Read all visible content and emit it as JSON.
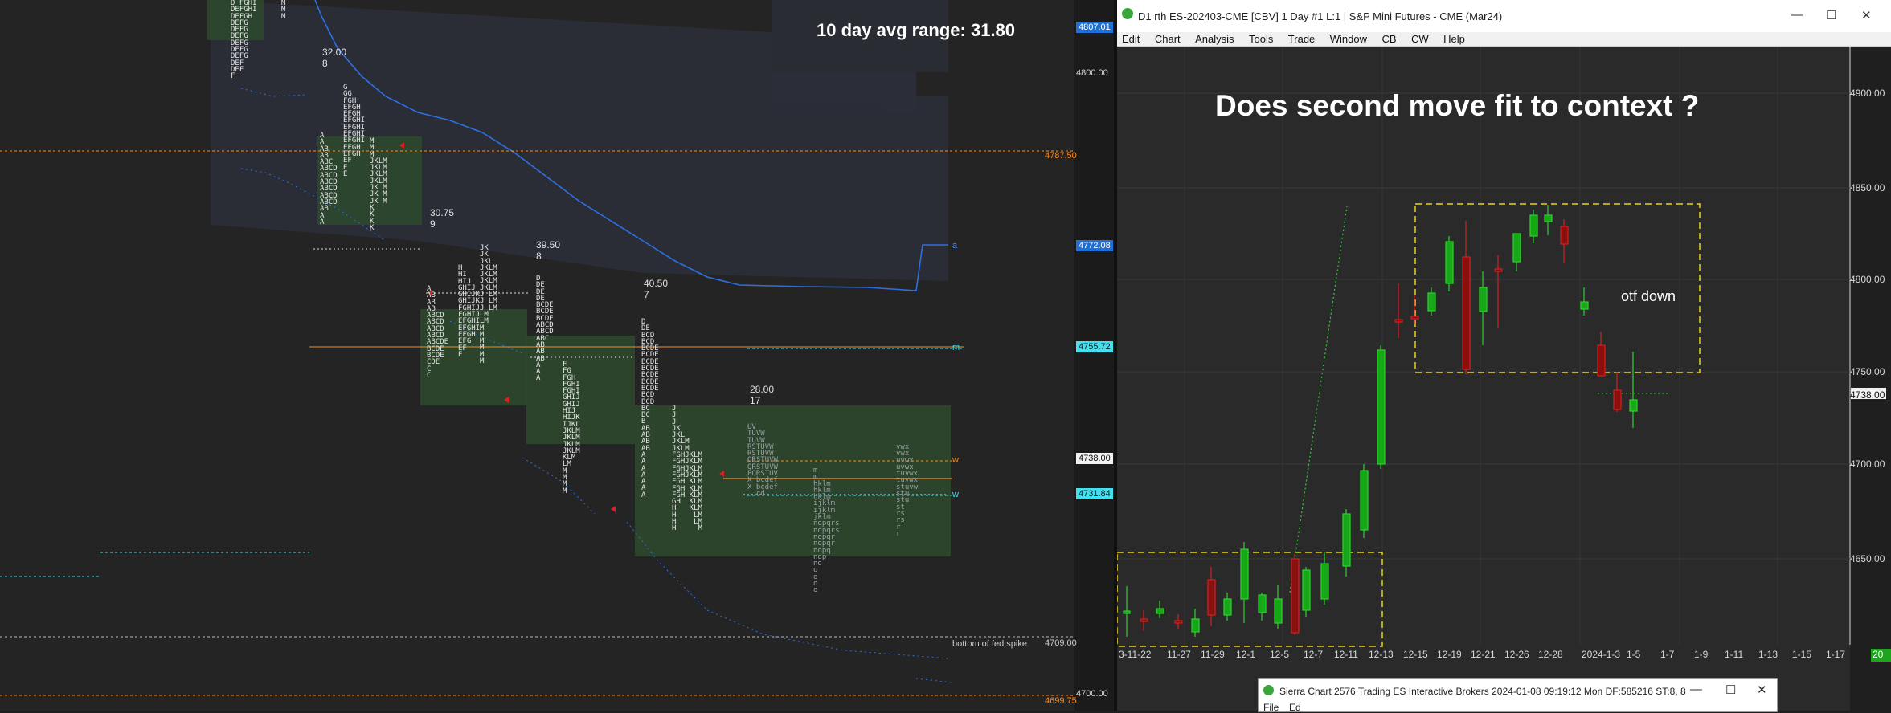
{
  "left_chart": {
    "headline": "10 day avg range:  31.80",
    "price_ticks": [
      "4800.00",
      "4700.00"
    ],
    "price_tags": [
      {
        "label": "4807.01",
        "color": "#ffffff",
        "bg": "#1e6fd6"
      },
      {
        "label": "4787.50",
        "color": "#ff8c1a",
        "bg": ""
      },
      {
        "label": "4772.08",
        "color": "#ffffff",
        "bg": "#1e6fd6"
      },
      {
        "label": "4755.72",
        "color": "#0b1f24",
        "bg": "#43e0f0"
      },
      {
        "label": "4738.00",
        "color": "#111111",
        "bg": "#f2f2f2"
      },
      {
        "label": "4731.84",
        "color": "#0b1f24",
        "bg": "#43e0f0"
      },
      {
        "label": "4709.00",
        "color": "#cccccc",
        "bg": ""
      },
      {
        "label": "4699.75",
        "color": "#ff8c1a",
        "bg": ""
      }
    ],
    "bottom_note": "bottom of fed spike",
    "line_labels": [
      "a",
      "m",
      "w",
      "w"
    ],
    "sessions": [
      {
        "range": "32.00",
        "count": "8"
      },
      {
        "range": "30.75",
        "count": "9"
      },
      {
        "range": "39.50",
        "count": "8"
      },
      {
        "range": "40.50",
        "count": "7"
      },
      {
        "range": "28.00",
        "count": "17"
      }
    ],
    "profiles": [
      {
        "col1": "D FGHI\nDEFGHI\nDEFGH\nDEFG\nDEFG\nDEFG\nDEFG\nDEFG\nDEFG\nDEF\nDEF\nF",
        "col2": "M\nM\nM"
      },
      {
        "col1": "A\nA\nAB\nAB\nABC\nABCD\nABCD\nABCD\nABCD\nABCD\nABCD\nAB\nA\nA",
        "col2": "G\nGG\nFGH\nEFGH\nEFGH\nEFGHI\nEFGHI\nEFGHI\nEFGHI\nEFGH\nEFGH\nEF\nE\nE",
        "col3": "M\nM\nM\nJKLM\nJKLM\nJKLM\nJKLM\nJK M\nJK M\nJK M\nK\nK\nK\nK"
      },
      {
        "col1": "A\nAB\nAB\nAB\nABCD\nABCD\nABCD\nABCD\nABCDE\nBCDE\nBCDE\nCDE\nC\nC",
        "col2": "H\nHI\nHIJ\nGHIJ\nGHIJK\nGHIJK\nFGHIJ\nFGHIJ\nEFGHI\nEFGHI\nEFGH\nEFG\nEF\nE",
        "col3": "JK\nJK\nJKL\nJKLM\nJKLM\nJKLM\nJKLM\nJ LM\nJ LM\nJ LM\nLM\nLM\nM\nM\nM\nM\nM\nM"
      },
      {
        "col1": "D\nDE\nDE\nDE\nBCDE\nBCDE\nBCDE\nABCD\nABCD\nABC\nAB\nAB\nAB\nA\nA\nA",
        "col2": "F\nFG\nFGH\nFGHI\nFGHI\nGHIJ\nGHIJ\nHIJ\nHIJK\nIJKL\nJKLM\nJKLM\nJKLM\nJKLM\nKLM\nLM\nM\nM\nM\nM"
      },
      {
        "col1": "D\nDE\nBCD\nBCD\nBCDE\nBCDE\nBCDE\nBCDE\nBCDE\nBCDE\nBCDE\nBCD\nBCD\nBC\nBC\nB\nAB\nAB\nAB\nAB\nA\nA\nA\nA\nA\nA\nA",
        "col2": "J\nJ\nJ\nJK\nJKL\nJKLM\nJKLM\nFGHJKLM\nFGHJKLM\nFGHJKLM\nFGHJKLM\nFGH KLM\nFGH KLM\nFGH KLM\nGH  KLM\nH   KLM\nH    LM\nH    LM\nH     M"
      },
      {
        "col1": "UV\nTUVW\nTUVW\nRSTUVW\nRSTUVW\nQRSTUVW\nQRSTUVW\nPQRSTUV\nX bcdef\nX bcdef\n  cd",
        "col2": "m\nm\nhklm\nhklm\nhklm\nijklm\nijklm\njklm\nnopqrs\nnopqrs\nnopqr\nnopqr\nnopq\nnop\nno\no\no\no\no",
        "col3": "vwx\nvwx\nuvwx\nuvwx\ntuvwx\ntuvwx\nstuvw\nstu\nstu\nst\nrs\nrs\nr\nr"
      }
    ]
  },
  "right_window": {
    "title": "D1 rth ES-202403-CME [CBV]  1 Day  #1 L:1 | S&P Mini Futures - CME (Mar24)",
    "menu": [
      "Edit",
      "Chart",
      "Analysis",
      "Tools",
      "Trade",
      "Window",
      "CB",
      "CW",
      "Help"
    ],
    "window_controls": [
      "—",
      "☐",
      "✕"
    ],
    "heading": "Does second move fit to context ?",
    "annotation": "otf down",
    "price_ticks": [
      "4900.00",
      "4850.00",
      "4800.00",
      "4750.00",
      "4700.00",
      "4650.00"
    ],
    "price_tag": "4738.00",
    "date_labels": [
      "3-11-22",
      "11-27",
      "11-29",
      "12-1",
      "12-5",
      "12-7",
      "12-11",
      "12-13",
      "12-15",
      "12-19",
      "12-21",
      "12-26",
      "12-28",
      "2024-1-3",
      "1-5",
      "1-7",
      "1-9",
      "1-11",
      "1-13",
      "1-15",
      "1-17"
    ],
    "corner_badge": "20"
  },
  "second_window": {
    "title": "Sierra Chart 2576 Trading ES Interactive Brokers 2024-01-08  09:19:12 Mon  DF:585216  ST:8, 8",
    "menu": [
      "File",
      "Ed"
    ],
    "window_controls": [
      "—",
      "☐",
      "✕"
    ]
  }
}
